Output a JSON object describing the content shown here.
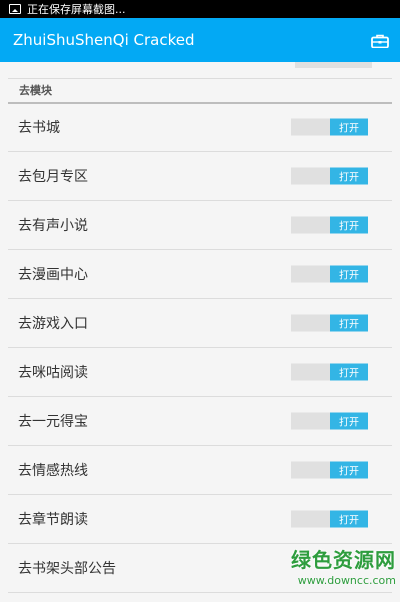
{
  "status_bar": {
    "icon": "image-icon",
    "text": "正在保存屏幕截图..."
  },
  "app_bar": {
    "title": "ZhuiShuShenQi Cracked",
    "action_icon": "briefcase-icon",
    "color": "#03a9f4"
  },
  "section": {
    "header": "去模块"
  },
  "items": [
    {
      "label": "去书城",
      "state": "打开"
    },
    {
      "label": "去包月专区",
      "state": "打开"
    },
    {
      "label": "去有声小说",
      "state": "打开"
    },
    {
      "label": "去漫画中心",
      "state": "打开"
    },
    {
      "label": "去游戏入口",
      "state": "打开"
    },
    {
      "label": "去咪咕阅读",
      "state": "打开"
    },
    {
      "label": "去一元得宝",
      "state": "打开"
    },
    {
      "label": "去情感热线",
      "state": "打开"
    },
    {
      "label": "去章节朗读",
      "state": "打开"
    },
    {
      "label": "去书架头部公告",
      "state": ""
    }
  ],
  "switch_on_color": "#33b5e5",
  "watermark": {
    "title": "绿色资源网",
    "url": "www.downcc.com"
  }
}
